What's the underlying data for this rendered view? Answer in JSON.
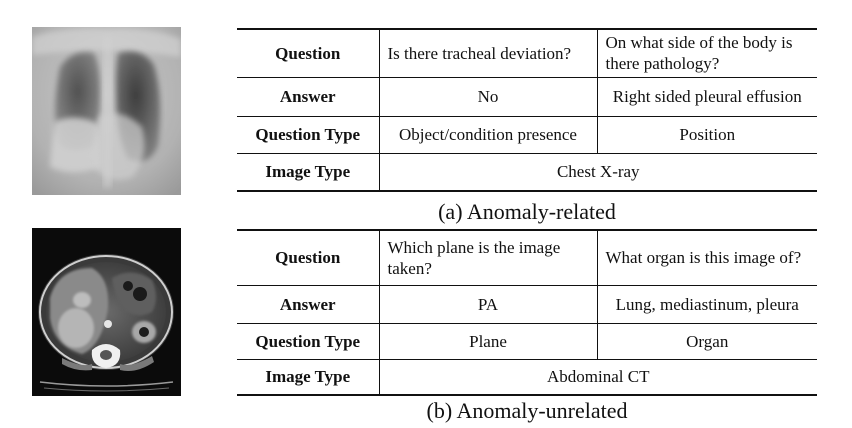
{
  "figure": {
    "panel_a": {
      "caption": "(a)  Anomaly-related",
      "image_alt": "Chest X-ray",
      "rows": {
        "question": {
          "label": "Question",
          "cells": [
            "Is there tracheal deviation?",
            "On what side of the body is there pathology?"
          ]
        },
        "answer": {
          "label": "Answer",
          "cells": [
            "No",
            "Right sided pleural effusion"
          ]
        },
        "question_type": {
          "label": "Question Type",
          "cells": [
            "Object/condition presence",
            "Position"
          ]
        },
        "image_type": {
          "label": "Image Type",
          "value": "Chest X-ray"
        }
      }
    },
    "panel_b": {
      "caption": "(b)  Anomaly-unrelated",
      "image_alt": "Abdominal CT",
      "rows": {
        "question": {
          "label": "Question",
          "cells": [
            "Which plane is the image taken?",
            "What organ is this image of?"
          ]
        },
        "answer": {
          "label": "Answer",
          "cells": [
            "PA",
            "Lung, mediastinum, pleura"
          ]
        },
        "question_type": {
          "label": "Question Type",
          "cells": [
            "Plane",
            "Organ"
          ]
        },
        "image_type": {
          "label": "Image Type",
          "value": "Abdominal CT"
        }
      }
    }
  }
}
